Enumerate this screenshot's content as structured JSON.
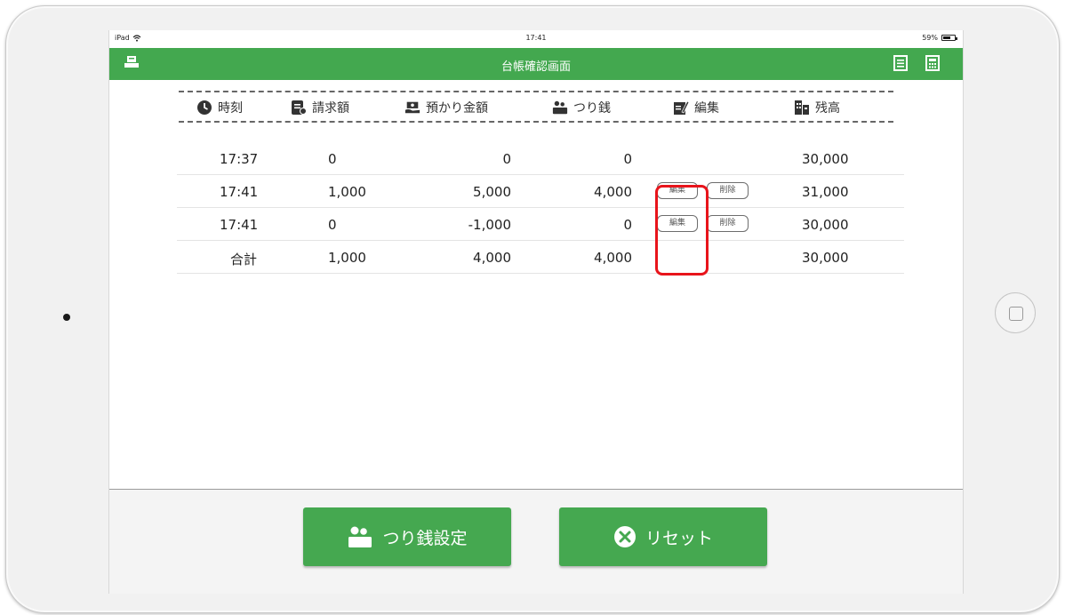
{
  "status_bar": {
    "device": "iPad",
    "time": "17:41",
    "battery": "59%"
  },
  "nav": {
    "title": "台帳確認画面"
  },
  "columns": {
    "time": "時刻",
    "billed": "請求額",
    "deposit": "預かり金額",
    "change": "つり銭",
    "edit": "編集",
    "balance": "残高"
  },
  "rows": [
    {
      "time": "17:37",
      "billed": "0",
      "deposit": "0",
      "change": "0",
      "balance": "30,000",
      "edit_label": "",
      "delete_label": ""
    },
    {
      "time": "17:41",
      "billed": "1,000",
      "deposit": "5,000",
      "change": "4,000",
      "balance": "31,000",
      "edit_label": "編集",
      "delete_label": "削除"
    },
    {
      "time": "17:41",
      "billed": "0",
      "deposit": "-1,000",
      "change": "0",
      "balance": "30,000",
      "edit_label": "編集",
      "delete_label": "削除"
    }
  ],
  "total": {
    "label": "合計",
    "billed": "1,000",
    "deposit": "4,000",
    "change": "4,000",
    "balance": "30,000"
  },
  "footer": {
    "change_setting": "つり銭設定",
    "reset": "リセット"
  },
  "colors": {
    "brand_green": "#43a84f",
    "highlight_red": "#e8141b"
  }
}
